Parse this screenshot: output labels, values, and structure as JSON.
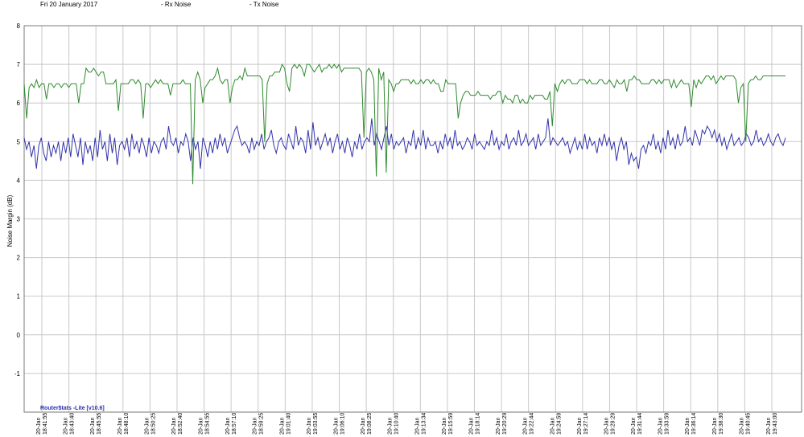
{
  "header": {
    "date": "Fri 20 January 2017",
    "legend": [
      {
        "label": "- Rx Noise",
        "color": "#3333aa"
      },
      {
        "label": "- Tx Noise",
        "color": "#2f8a2f"
      }
    ]
  },
  "brand": "Router$tats -Lite [v10.6]",
  "chart_data": {
    "type": "line",
    "ylabel": "Noise Margin (dB)",
    "ylim": [
      -2,
      8
    ],
    "yticks": [
      8,
      7,
      6,
      5,
      4,
      3,
      2,
      1,
      0,
      -1
    ],
    "grid": true,
    "x_tick_date": "20-Jan",
    "x_tick_times": [
      "18:41:55",
      "18:43:40",
      "18:45:55",
      "18:48:10",
      "18:50:25",
      "18:52:40",
      "18:54:55",
      "18:57:10",
      "18:59:25",
      "19:01:40",
      "19:03:55",
      "19:06:10",
      "19:08:25",
      "19:10:40",
      "19:13:34",
      "19:15:59",
      "19:18:14",
      "19:20:29",
      "19:22:44",
      "19:24:59",
      "19:27:14",
      "19:29:29",
      "19:31:44",
      "19:33:59",
      "19:36:14",
      "19:38:30",
      "19:40:45",
      "19:43:00"
    ],
    "series": [
      {
        "name": "Rx Noise",
        "color": "#3333aa",
        "values": [
          5.1,
          4.8,
          5.0,
          4.6,
          4.9,
          4.3,
          4.9,
          5.1,
          4.7,
          4.5,
          5.0,
          4.6,
          4.9,
          4.7,
          5.0,
          4.5,
          5.0,
          4.7,
          5.1,
          4.6,
          5.2,
          4.9,
          4.6,
          5.1,
          4.4,
          5.0,
          4.7,
          4.9,
          4.5,
          5.1,
          4.6,
          5.3,
          4.8,
          5.0,
          4.5,
          5.2,
          4.7,
          5.1,
          4.4,
          4.9,
          5.0,
          4.8,
          5.1,
          4.6,
          5.2,
          4.8,
          5.0,
          4.7,
          5.1,
          4.9,
          4.6,
          5.1,
          4.7,
          5.0,
          4.9,
          4.7,
          5.0,
          5.1,
          4.8,
          5.4,
          5.0,
          4.9,
          5.1,
          4.7,
          5.0,
          4.9,
          5.2,
          5.0,
          4.5,
          5.1,
          4.8,
          5.0,
          4.3,
          5.1,
          4.9,
          4.6,
          5.0,
          4.7,
          5.1,
          4.8,
          5.2,
          4.9,
          5.1,
          4.7,
          4.9,
          5.1,
          5.3,
          5.4,
          5.1,
          4.9,
          5.0,
          4.9,
          4.7,
          5.1,
          4.8,
          5.0,
          4.9,
          5.2,
          4.8,
          5.0,
          5.1,
          5.3,
          4.9,
          4.7,
          5.0,
          5.1,
          4.9,
          4.8,
          5.2,
          5.0,
          4.8,
          5.4,
          4.9,
          5.1,
          5.0,
          4.7,
          5.3,
          4.8,
          5.5,
          4.9,
          5.1,
          4.8,
          5.0,
          5.2,
          4.9,
          5.1,
          4.7,
          5.0,
          5.2,
          4.8,
          5.0,
          4.7,
          5.1,
          4.9,
          4.6,
          5.0,
          4.8,
          5.2,
          4.8,
          5.0,
          5.1,
          5.0,
          5.6,
          4.9,
          5.2,
          5.0,
          4.8,
          5.1,
          5.4,
          4.9,
          5.2,
          4.8,
          5.0,
          4.9,
          5.0,
          5.1,
          4.7,
          5.0,
          4.9,
          5.3,
          4.8,
          5.1,
          4.9,
          5.3,
          4.8,
          5.1,
          4.9,
          4.9,
          5.0,
          4.7,
          5.0,
          4.8,
          5.2,
          4.9,
          5.1,
          4.8,
          5.3,
          4.9,
          5.0,
          4.8,
          4.9,
          5.1,
          5.0,
          4.8,
          5.2,
          4.9,
          5.0,
          4.9,
          4.8,
          5.0,
          4.9,
          5.3,
          4.9,
          5.1,
          4.8,
          5.0,
          4.9,
          5.2,
          4.8,
          5.0,
          5.1,
          4.9,
          5.3,
          4.9,
          5.0,
          5.2,
          4.9,
          5.0,
          5.1,
          4.8,
          5.2,
          4.9,
          5.0,
          5.1,
          5.6,
          4.9,
          5.1,
          5.0,
          4.9,
          5.0,
          5.1,
          4.9,
          5.0,
          4.7,
          4.9,
          5.1,
          4.8,
          5.0,
          4.8,
          5.2,
          4.8,
          5.1,
          4.9,
          5.0,
          4.7,
          5.1,
          4.9,
          5.2,
          4.9,
          5.1,
          4.8,
          5.0,
          4.5,
          4.9,
          5.1,
          4.8,
          5.0,
          4.4,
          4.7,
          4.5,
          4.6,
          4.3,
          4.8,
          4.9,
          4.7,
          5.0,
          4.9,
          5.2,
          4.8,
          5.0,
          4.7,
          5.1,
          4.8,
          5.3,
          4.9,
          5.1,
          4.8,
          5.2,
          4.9,
          5.0,
          5.4,
          5.0,
          5.1,
          4.9,
          5.3,
          5.1,
          4.9,
          5.3,
          5.2,
          5.4,
          5.3,
          5.1,
          5.3,
          5.0,
          5.2,
          4.9,
          5.1,
          4.8,
          5.0,
          5.2,
          4.9,
          5.0,
          5.1,
          4.9,
          5.0,
          5.2,
          5.1,
          4.9,
          5.0,
          5.3,
          5.0,
          5.1,
          4.9,
          5.0,
          5.2,
          5.0,
          4.9,
          5.1,
          5.2,
          5.0,
          4.9,
          5.1
        ]
      },
      {
        "name": "Tx Noise",
        "color": "#2f8a2f",
        "values": [
          6.5,
          5.6,
          6.4,
          6.5,
          6.4,
          6.6,
          6.4,
          6.5,
          6.5,
          6.1,
          6.5,
          6.5,
          6.4,
          6.5,
          6.5,
          6.4,
          6.5,
          6.5,
          6.4,
          6.5,
          6.5,
          6.5,
          6.0,
          6.5,
          6.5,
          6.9,
          6.8,
          6.8,
          6.9,
          6.8,
          6.7,
          6.8,
          6.8,
          6.5,
          6.5,
          6.5,
          6.5,
          6.6,
          5.8,
          6.5,
          6.5,
          6.5,
          6.5,
          6.6,
          6.6,
          6.5,
          6.6,
          6.5,
          5.6,
          6.5,
          6.5,
          6.4,
          6.5,
          6.6,
          6.5,
          6.6,
          6.5,
          6.5,
          6.5,
          6.2,
          6.5,
          6.5,
          6.5,
          6.5,
          6.6,
          6.5,
          6.5,
          6.5,
          3.9,
          6.6,
          6.8,
          6.6,
          6.0,
          6.4,
          6.5,
          6.6,
          6.6,
          6.7,
          6.9,
          6.6,
          6.5,
          6.6,
          6.6,
          6.0,
          6.4,
          6.6,
          6.6,
          6.7,
          6.6,
          6.9,
          6.7,
          6.7,
          6.7,
          6.7,
          6.7,
          6.7,
          6.6,
          5.0,
          6.5,
          6.7,
          6.7,
          6.8,
          6.8,
          6.8,
          7.0,
          6.9,
          6.5,
          6.3,
          6.9,
          7.0,
          6.9,
          7.0,
          6.9,
          6.7,
          7.0,
          7.0,
          6.9,
          6.8,
          6.9,
          7.0,
          6.8,
          6.9,
          6.9,
          7.0,
          6.9,
          7.0,
          6.9,
          7.0,
          6.8,
          6.9,
          6.9,
          6.9,
          6.9,
          6.9,
          6.9,
          6.9,
          6.8,
          5.1,
          6.8,
          6.9,
          6.8,
          6.6,
          4.1,
          6.9,
          6.6,
          6.8,
          4.2,
          6.6,
          6.5,
          6.3,
          6.5,
          6.5,
          6.6,
          6.6,
          6.6,
          6.6,
          6.5,
          6.6,
          6.5,
          6.5,
          6.6,
          6.5,
          6.6,
          6.6,
          6.5,
          6.6,
          6.5,
          6.5,
          6.3,
          6.3,
          6.6,
          6.5,
          6.5,
          6.5,
          6.5,
          5.6,
          6.0,
          6.2,
          6.3,
          6.3,
          6.2,
          6.2,
          6.2,
          6.3,
          6.2,
          6.2,
          6.2,
          6.2,
          6.1,
          6.2,
          6.2,
          6.3,
          6.3,
          6.0,
          6.2,
          6.1,
          6.1,
          6.0,
          6.2,
          6.2,
          6.0,
          6.1,
          6.0,
          6.0,
          6.2,
          6.1,
          6.2,
          6.2,
          6.2,
          6.2,
          6.1,
          6.1,
          6.3,
          5.4,
          6.5,
          6.3,
          6.5,
          6.6,
          6.5,
          6.6,
          6.6,
          6.5,
          6.5,
          6.5,
          6.6,
          6.6,
          6.6,
          6.5,
          6.6,
          6.5,
          6.5,
          6.5,
          6.6,
          6.6,
          6.5,
          6.5,
          6.6,
          6.5,
          6.4,
          6.6,
          6.5,
          6.5,
          6.6,
          6.3,
          6.6,
          6.6,
          6.7,
          6.6,
          6.6,
          6.5,
          6.5,
          6.5,
          6.5,
          6.6,
          6.6,
          6.5,
          6.6,
          6.5,
          6.6,
          6.6,
          6.6,
          6.4,
          6.6,
          6.4,
          6.5,
          6.6,
          6.5,
          6.5,
          6.5,
          5.9,
          6.6,
          6.4,
          6.6,
          6.5,
          6.6,
          6.7,
          6.7,
          6.6,
          6.7,
          6.5,
          6.6,
          6.7,
          6.6,
          6.7,
          6.7,
          6.7,
          6.7,
          6.6,
          6.0,
          6.4,
          6.5,
          5.0,
          6.5,
          6.6,
          6.6,
          6.7,
          6.6,
          6.6,
          6.7,
          6.7,
          6.7,
          6.7,
          6.7,
          6.7,
          6.7,
          6.7,
          6.7,
          6.7
        ]
      }
    ]
  }
}
